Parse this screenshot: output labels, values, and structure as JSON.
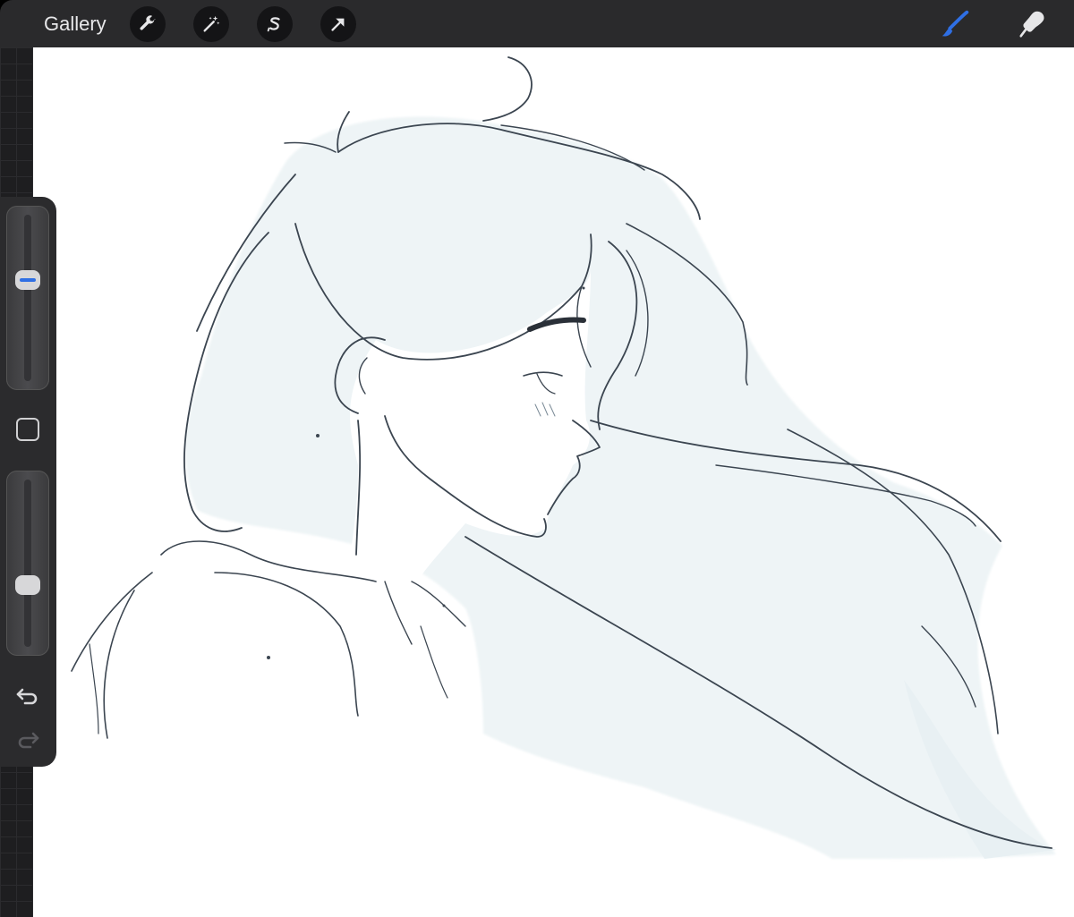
{
  "toolbar": {
    "gallery_label": "Gallery",
    "actions_icon": "wrench-icon",
    "adjustments_icon": "magic-wand-icon",
    "selection_icon": "selection-s-icon",
    "transform_icon": "transform-arrow-icon",
    "brush_icon": "brush-icon",
    "smudge_icon": "smudge-icon",
    "active_color": "#2f6fe4"
  },
  "sidebar": {
    "brush_size_level": 0.62,
    "opacity_level": 0.35,
    "modify_button_icon": "square-icon",
    "undo_icon": "undo-icon",
    "redo_icon": "redo-icon"
  },
  "canvas": {
    "background": "#ffffff",
    "fill_color": "#eef4f6",
    "line_color": "#3b4550"
  }
}
